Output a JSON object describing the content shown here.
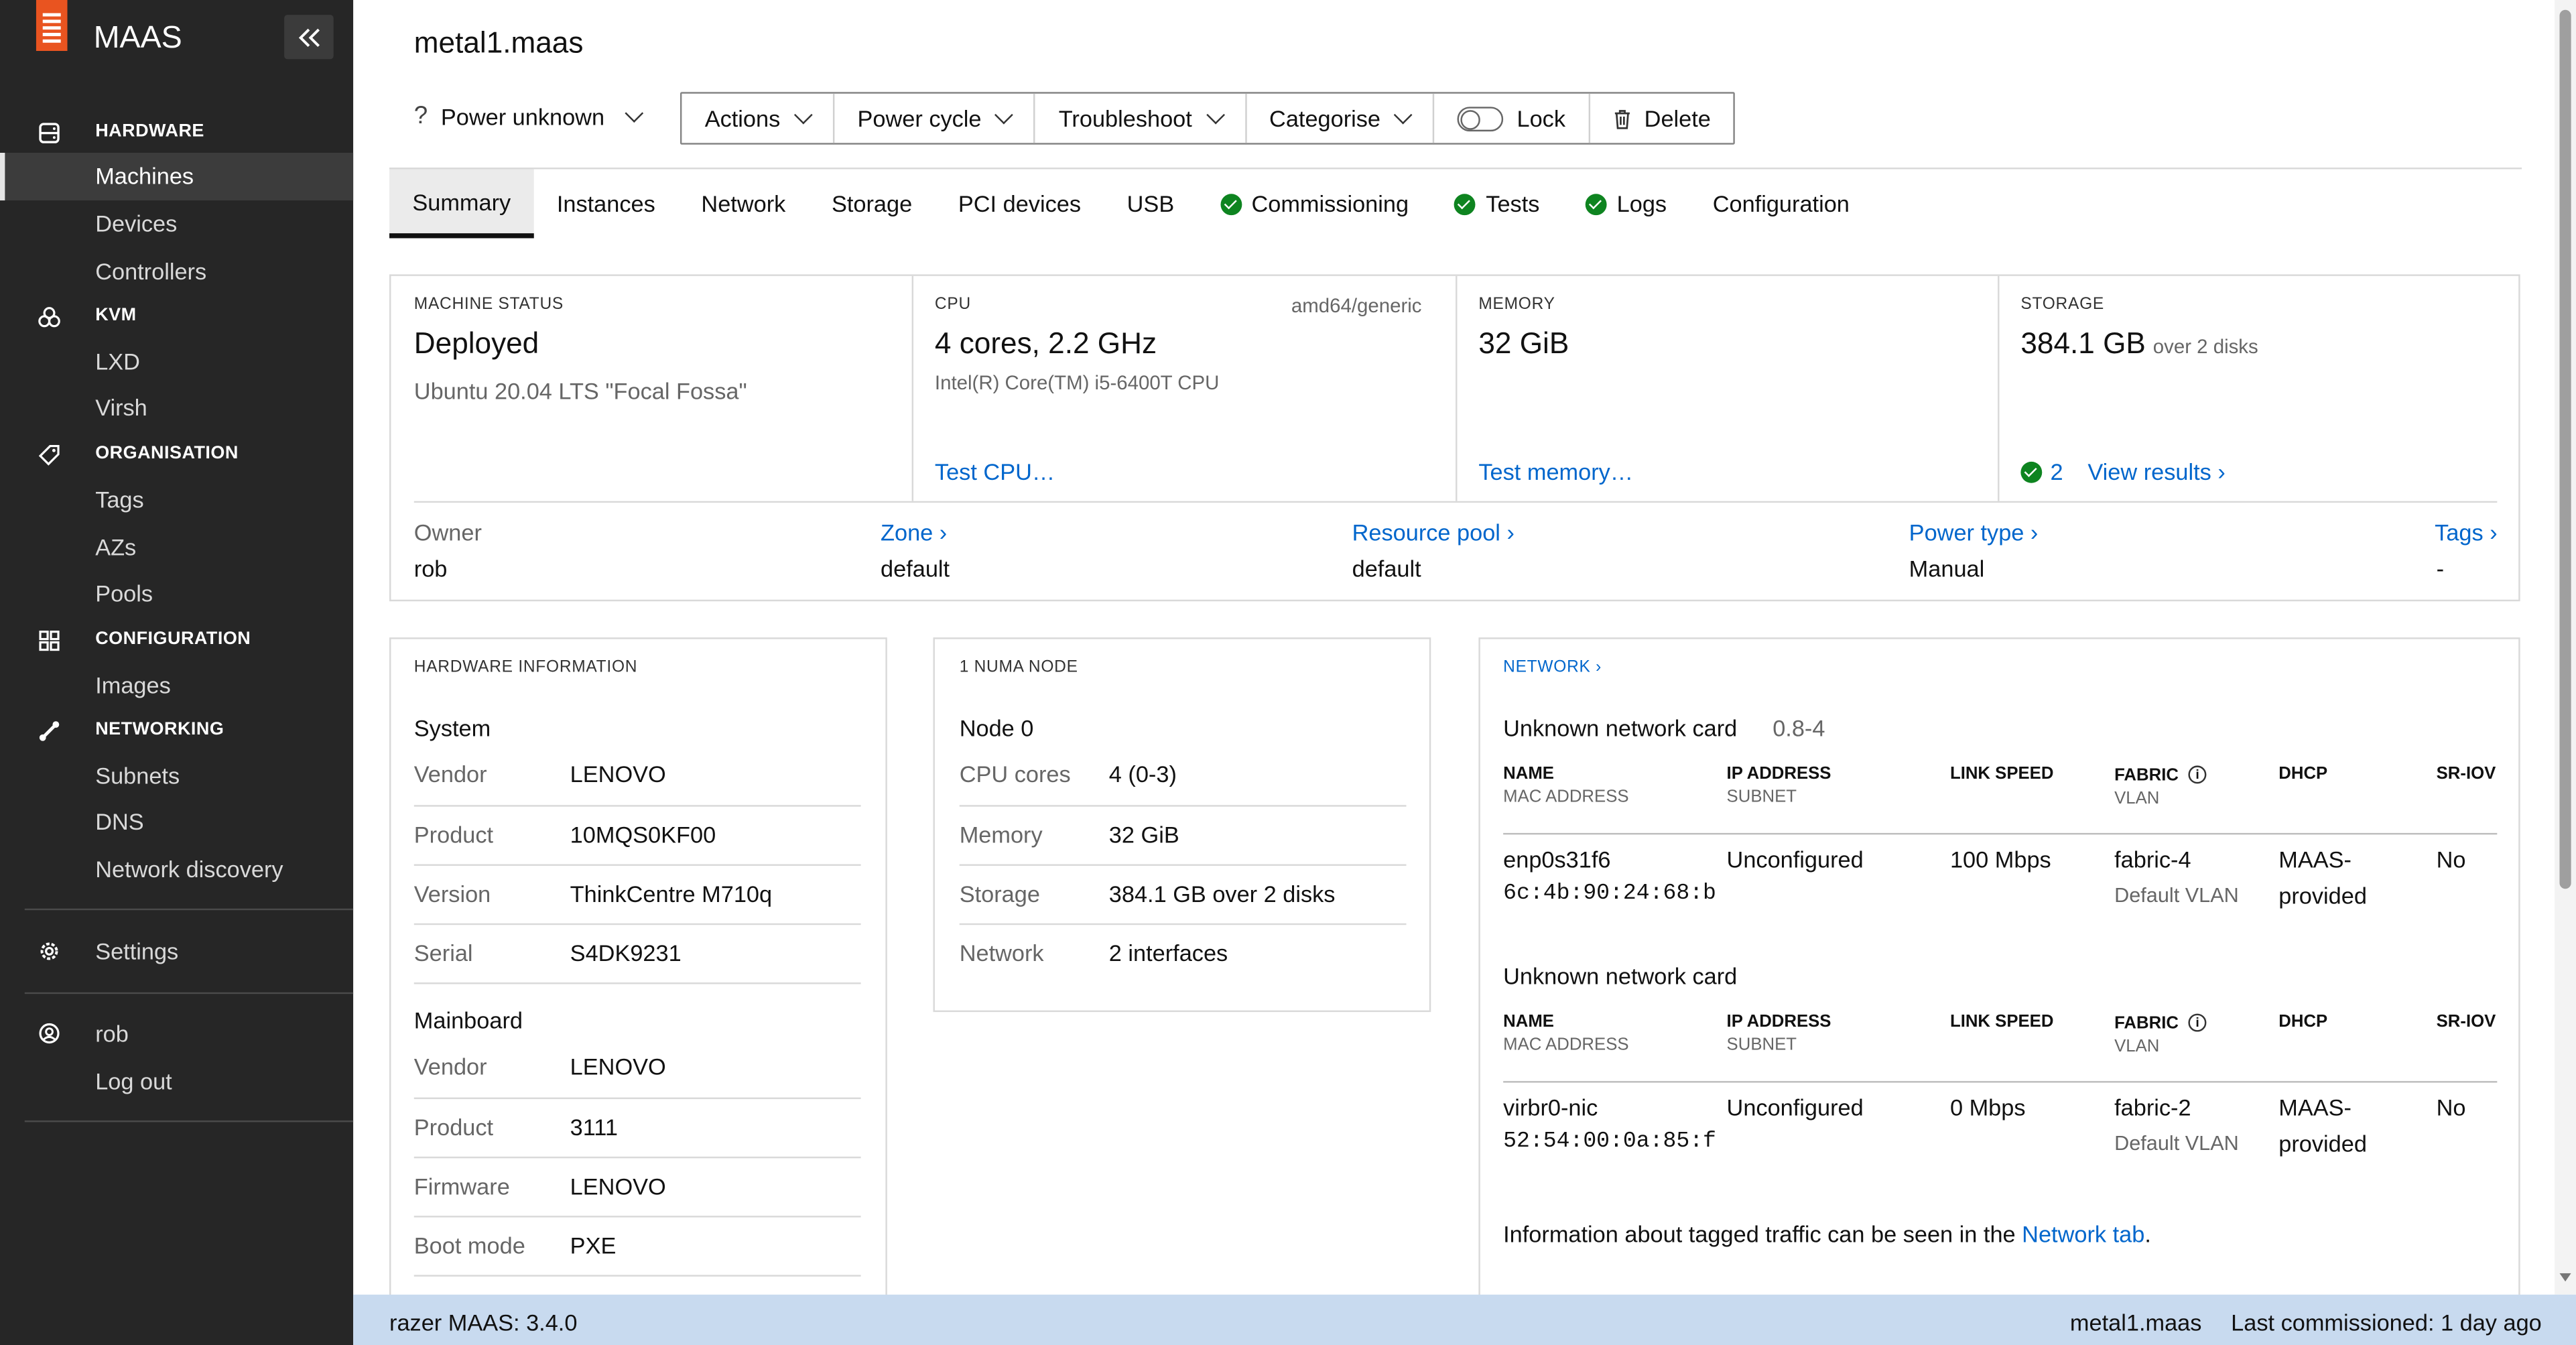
{
  "app": {
    "brand": "MAAS"
  },
  "sidebar": {
    "hardware": {
      "heading": "HARDWARE",
      "items": [
        "Machines",
        "Devices",
        "Controllers"
      ]
    },
    "kvm": {
      "heading": "KVM",
      "items": [
        "LXD",
        "Virsh"
      ]
    },
    "organisation": {
      "heading": "ORGANISATION",
      "items": [
        "Tags",
        "AZs",
        "Pools"
      ]
    },
    "configuration": {
      "heading": "CONFIGURATION",
      "items": [
        "Images"
      ]
    },
    "networking": {
      "heading": "NETWORKING",
      "items": [
        "Subnets",
        "DNS",
        "Network discovery"
      ]
    },
    "settings": "Settings",
    "user": "rob",
    "logout": "Log out"
  },
  "header": {
    "title": "metal1.maas",
    "power": {
      "icon": "?",
      "label": "Power unknown"
    },
    "actions": [
      "Actions",
      "Power cycle",
      "Troubleshoot",
      "Categorise"
    ],
    "lock": "Lock",
    "delete": "Delete"
  },
  "tabs": [
    "Summary",
    "Instances",
    "Network",
    "Storage",
    "PCI devices",
    "USB",
    "Commissioning",
    "Tests",
    "Logs",
    "Configuration"
  ],
  "summary": {
    "status": {
      "caption": "MACHINE STATUS",
      "value": "Deployed",
      "os": "Ubuntu 20.04 LTS \"Focal Fossa\""
    },
    "cpu": {
      "caption": "CPU",
      "arch": "amd64/generic",
      "value": "4 cores, 2.2 GHz",
      "model": "Intel(R) Core(TM) i5-6400T CPU",
      "link": "Test CPU…"
    },
    "memory": {
      "caption": "MEMORY",
      "value": "32 GiB",
      "link": "Test memory…"
    },
    "storage": {
      "caption": "STORAGE",
      "value": "384.1 GB",
      "sub": "over 2 disks",
      "passed": "2",
      "link": "View results ›"
    },
    "owner": {
      "label": "Owner",
      "value": "rob"
    },
    "zone": {
      "label": "Zone ›",
      "value": "default"
    },
    "pool": {
      "label": "Resource pool ›",
      "value": "default"
    },
    "power_type": {
      "label": "Power type ›",
      "value": "Manual"
    },
    "tags": {
      "label": "Tags ›",
      "value": "-"
    }
  },
  "hardware": {
    "caption": "HARDWARE INFORMATION",
    "system_title": "System",
    "system": [
      {
        "label": "Vendor",
        "value": "LENOVO"
      },
      {
        "label": "Product",
        "value": "10MQS0KF00"
      },
      {
        "label": "Version",
        "value": "ThinkCentre M710q"
      },
      {
        "label": "Serial",
        "value": "S4DK9231"
      }
    ],
    "mainboard_title": "Mainboard",
    "mainboard": [
      {
        "label": "Vendor",
        "value": "LENOVO"
      },
      {
        "label": "Product",
        "value": "3111"
      },
      {
        "label": "Firmware",
        "value": "LENOVO"
      },
      {
        "label": "Boot mode",
        "value": "PXE"
      }
    ]
  },
  "numa": {
    "caption": "1 NUMA NODE",
    "node": "Node 0",
    "rows": [
      {
        "label": "CPU cores",
        "value": "4 (0-3)"
      },
      {
        "label": "Memory",
        "value": "32 GiB"
      },
      {
        "label": "Storage",
        "value": "384.1 GB over 2 disks"
      },
      {
        "label": "Network",
        "value": "2 interfaces"
      }
    ]
  },
  "network": {
    "caption": "NETWORK ›",
    "columns": {
      "name": "NAME",
      "mac": "MAC ADDRESS",
      "ip": "IP ADDRESS",
      "subnet": "SUBNET",
      "speed": "LINK SPEED",
      "fabric": "FABRIC",
      "vlan": "VLAN",
      "dhcp": "DHCP",
      "sriov": "SR-IOV"
    },
    "cards": [
      {
        "title": "Unknown network card",
        "version": "0.8-4",
        "name": "enp0s31f6",
        "mac": "6c:4b:90:24:68:b",
        "ip": "Unconfigured",
        "speed": "100 Mbps",
        "fabric": "fabric-4",
        "vlan": "Default VLAN",
        "dhcp1": "MAAS-",
        "dhcp2": "provided",
        "sriov": "No"
      },
      {
        "title": "Unknown network card",
        "version": "",
        "name": "virbr0-nic",
        "mac": "52:54:00:0a:85:f",
        "ip": "Unconfigured",
        "speed": "0 Mbps",
        "fabric": "fabric-2",
        "vlan": "Default VLAN",
        "dhcp1": "MAAS-",
        "dhcp2": "provided",
        "sriov": "No"
      }
    ],
    "note": "Information about tagged traffic can be seen in the",
    "note_link": "Network tab",
    "note_end": "."
  },
  "footer": {
    "host": "razer MAAS",
    "version": ": 3.4.0",
    "machine": "metal1.maas",
    "commissioned": "Last commissioned: 1 day ago"
  },
  "colors": {
    "sidebar": "#262626",
    "accent": "#e95420",
    "link": "#0066cc",
    "success": "#0e8420",
    "footer": "#c8daef"
  }
}
